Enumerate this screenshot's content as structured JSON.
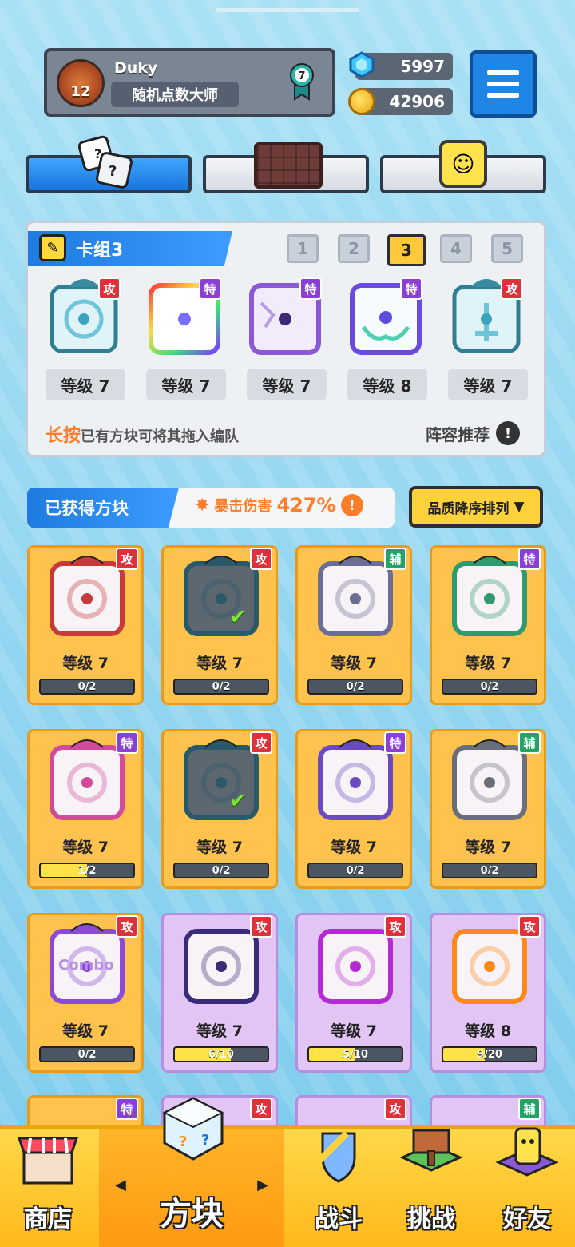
{
  "profile": {
    "name": "Duky",
    "title": "随机点数大师",
    "level": "12",
    "medal_rank": "7"
  },
  "currency": {
    "gems": "5997",
    "coins": "42906"
  },
  "deck": {
    "title": "卡组3",
    "numbers": [
      "1",
      "2",
      "3",
      "4",
      "5"
    ],
    "selected": "3",
    "cards": [
      {
        "tag": "攻",
        "level": "等级 7"
      },
      {
        "tag": "特",
        "level": "等级 7"
      },
      {
        "tag": "特",
        "level": "等级 7"
      },
      {
        "tag": "特",
        "level": "等级 8"
      },
      {
        "tag": "攻",
        "level": "等级 7"
      }
    ],
    "hint_highlight": "长按",
    "hint_text": "已有方块可将其拖入编队",
    "recommend": "阵容推荐"
  },
  "obtained": {
    "label": "已获得方块",
    "crit_label": "暴击伤害",
    "crit_value": "427%",
    "sort": "品质降序排列"
  },
  "grid": [
    {
      "tag": "攻",
      "level": "等级 7",
      "progress": "0/2",
      "fill": 0
    },
    {
      "tag": "攻",
      "level": "等级 7",
      "progress": "0/2",
      "fill": 0
    },
    {
      "tag": "辅",
      "level": "等级 7",
      "progress": "0/2",
      "fill": 0
    },
    {
      "tag": "特",
      "level": "等级 7",
      "progress": "0/2",
      "fill": 0
    },
    {
      "tag": "特",
      "level": "等级 7",
      "progress": "1/2",
      "fill": 0.5
    },
    {
      "tag": "攻",
      "level": "等级 7",
      "progress": "0/2",
      "fill": 0
    },
    {
      "tag": "特",
      "level": "等级 7",
      "progress": "0/2",
      "fill": 0
    },
    {
      "tag": "辅",
      "level": "等级 7",
      "progress": "0/2",
      "fill": 0
    },
    {
      "tag": "攻",
      "level": "等级 7",
      "progress": "0/2",
      "fill": 0,
      "text": "Combo"
    },
    {
      "tag": "攻",
      "level": "等级 7",
      "progress": "6/10",
      "fill": 0.6
    },
    {
      "tag": "攻",
      "level": "等级 7",
      "progress": "5/10",
      "fill": 0.5
    },
    {
      "tag": "攻",
      "level": "等级 8",
      "progress": "9/20",
      "fill": 0.45
    }
  ],
  "partial_tags": [
    "特",
    "攻",
    "攻",
    "辅"
  ],
  "nav": {
    "shop": "商店",
    "blocks": "方块",
    "battle": "战斗",
    "challenge": "挑战",
    "friends": "好友"
  },
  "colors": {
    "attack": "#e0313a",
    "special": "#8a3fd6",
    "support": "#26a266",
    "accent": "#1f86e6"
  }
}
